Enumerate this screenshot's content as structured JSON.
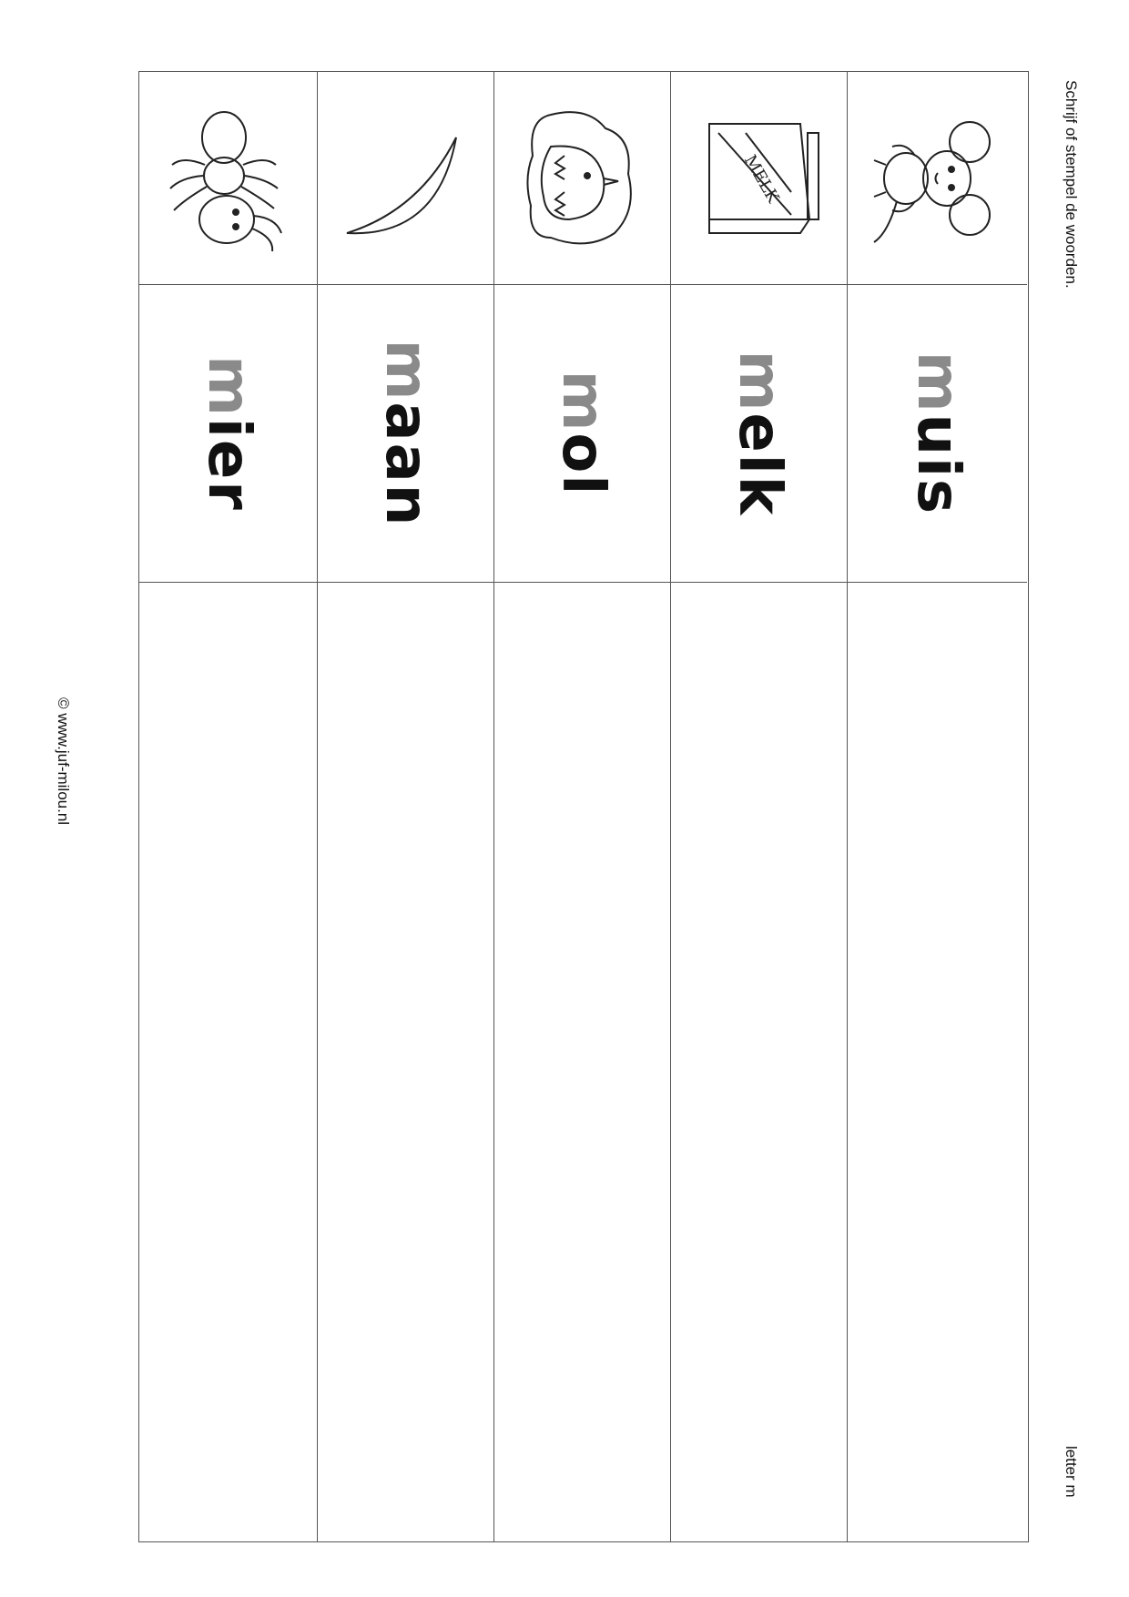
{
  "header": {
    "instruction": "Schrijf of stempel de woorden.",
    "letter_label": "letter m"
  },
  "footer": {
    "copyright": "© www.juf-milou.nl"
  },
  "rows": [
    {
      "word_first": "m",
      "word_rest": "ier",
      "picture": "ant-icon"
    },
    {
      "word_first": "m",
      "word_rest": "aan",
      "picture": "moon-icon"
    },
    {
      "word_first": "m",
      "word_rest": "ol",
      "picture": "mole-icon"
    },
    {
      "word_first": "m",
      "word_rest": "elk",
      "picture": "milk-carton-icon",
      "picture_text": "MELK"
    },
    {
      "word_first": "m",
      "word_rest": "uis",
      "picture": "mouse-icon"
    }
  ],
  "colors": {
    "highlight_letter": "#8a8a8a",
    "text": "#111111",
    "lines": "#555555"
  }
}
